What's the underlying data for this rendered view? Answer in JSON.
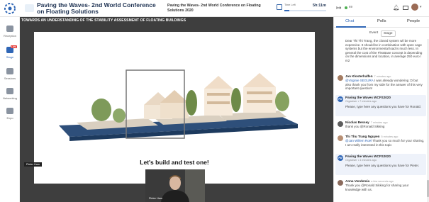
{
  "topbar": {
    "conference_title": "Paving the Waves- 2nd World Conference on Floating Solutions",
    "session_title": "Paving the Waves- 2nd World Conference on Floating Solutions 2020",
    "timer_label": "Time Left",
    "timer_value": "5h:11m",
    "timer_progress_fraction": 0.12,
    "live_count": "69"
  },
  "nav": {
    "items": [
      {
        "label": "Reception"
      },
      {
        "label": "Stage",
        "badge": "LIVE"
      },
      {
        "label": "Sessions"
      },
      {
        "label": "Networking"
      },
      {
        "label": "Expo"
      }
    ]
  },
  "stage": {
    "title": "TOWARDS AN UNDERSTANDING OF THE STABILITY ASSESSMENT OF FLOATING BUILDINGS",
    "slide_caption": "Let's build and test one!",
    "presenter_tag": "Pieter Ham",
    "camera_name": "Pieter Ham"
  },
  "panel": {
    "tabs": [
      "Chat",
      "Polls",
      "People"
    ],
    "subtabs": [
      "Event",
      "Stage"
    ],
    "messages": [
      {
        "name": "",
        "time": "",
        "role": "",
        "text": "Dear Thi Thi Trang, the closed system wil be more expensive. It should be in combination with open cage systems but the environmental load is much less. In general the cost of the FlexBase concept is depending on the dimensions and location, in average 250 euro / m2"
      },
      {
        "name": "Jan Klosterhalfen",
        "time": "7 minutes ago",
        "role": "",
        "mention": "@Virginie SEGURA",
        "text": " I was already wondering :D but also thank you from my side for the answer of this very important question!"
      },
      {
        "name": "Paving the Waves WCFS2020",
        "time": "",
        "role": "Organiser • 7 minutes ago",
        "text": "Please, type here any questions you have for Ronald."
      },
      {
        "name": "Nicolas Bessey",
        "time": "7 minutes ago",
        "role": "",
        "mention": "",
        "text": "thank you @Ronald Sikking"
      },
      {
        "name": "Thi Thu Trang Nguyen",
        "time": "5 minutes ago",
        "role": "",
        "mention": "@Jan Willem Roël",
        "text": " Thank you so much for your sharing, I am really interested in this topic"
      },
      {
        "name": "Paving the Waves WCFS2020",
        "time": "",
        "role": "Organiser • 4 minutes ago",
        "text": "Please, type here any questions you have for Pieter."
      },
      {
        "name": "Anna Vendemia",
        "time": "a few seconds ago",
        "role": "",
        "text": "Thank you @Ronald Sikking for sharing your knowledge with us."
      }
    ]
  },
  "colors": {
    "accent": "#2f66b6",
    "stage_bg": "#3e3e3e",
    "live_badge": "#e53935",
    "organiser_bubble": "#eef2fa"
  }
}
